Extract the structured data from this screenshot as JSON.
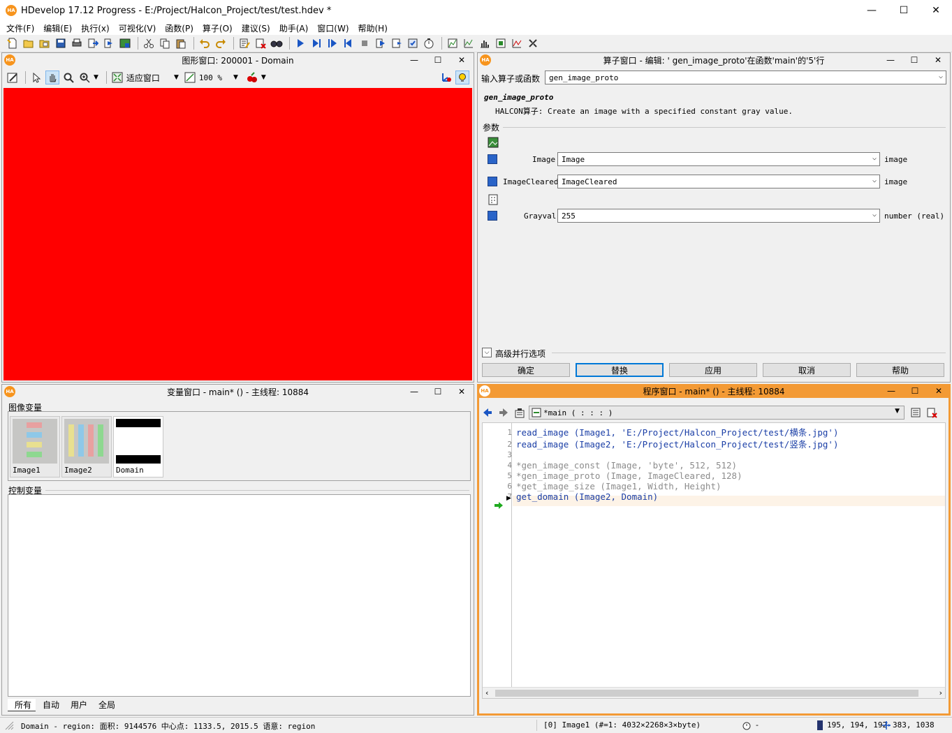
{
  "window": {
    "title": "HDevelop 17.12 Progress - E:/Project/Halcon_Project/test/test.hdev *",
    "logo": "HA",
    "minimize": "—",
    "maximize": "☐",
    "close": "✕"
  },
  "menu": [
    "文件(F)",
    "编辑(E)",
    "执行(x)",
    "可视化(V)",
    "函数(P)",
    "算子(O)",
    "建议(S)",
    "助手(A)",
    "窗口(W)",
    "帮助(H)"
  ],
  "graphics_window": {
    "title": "图形窗口: 200001 - Domain",
    "fit_label": "适应窗口",
    "zoom_label": "100 %",
    "canvas_color": "#ff0000"
  },
  "operator_window": {
    "title": "算子窗口 - 编辑: ' gen_image_proto'在函数'main'的'5'行",
    "input_label": "输入算子或函数",
    "input_value": "gen_image_proto",
    "op_name": "gen_image_proto",
    "op_desc": "HALCON算子: Create an image with a specified constant gray value.",
    "params_label": "参数",
    "params": [
      {
        "name": "Image",
        "value": "Image",
        "type": "image"
      },
      {
        "name": "ImageCleared",
        "value": "ImageCleared",
        "type": "image"
      },
      {
        "name": "Grayval",
        "value": "255",
        "type": "number (real)"
      }
    ],
    "advanced_label": "高级并行选项",
    "buttons": {
      "ok": "确定",
      "replace": "替换",
      "apply": "应用",
      "cancel": "取消",
      "help": "帮助"
    }
  },
  "variable_window": {
    "title": "变量窗口 - main* () - 主线程: 10884",
    "image_vars_label": "图像变量",
    "image_vars": [
      "Image1",
      "Image2",
      "Domain"
    ],
    "control_vars_label": "控制变量",
    "tabs": [
      "所有",
      "自动",
      "用户",
      "全局"
    ]
  },
  "program_window": {
    "title": "程序窗口 - main* () - 主线程: 10884",
    "proc_select": "main ( : : : )",
    "proc_marker": "*",
    "lines": [
      {
        "n": "1",
        "text": "read_image (Image1, 'E:/Project/Halcon_Project/test/横条.jpg')",
        "style": "blue"
      },
      {
        "n": "2",
        "text": "read_image (Image2, 'E:/Project/Halcon_Project/test/竖条.jpg')",
        "style": "blue"
      },
      {
        "n": "3",
        "text": "",
        "style": "blue"
      },
      {
        "n": "4",
        "text": "*gen_image_const (Image, 'byte', 512, 512)",
        "style": "gray"
      },
      {
        "n": "5",
        "text": "*gen_image_proto (Image, ImageCleared, 128)",
        "style": "gray"
      },
      {
        "n": "6",
        "text": "*get_image_size (Image1, Width, Height)",
        "style": "gray"
      },
      {
        "n": "7",
        "text": "get_domain (Image2, Domain)",
        "style": "blue"
      }
    ]
  },
  "status": {
    "left": "Domain - region: 面积: 9144576 中心点: 1133.5, 2015.5 语意: region",
    "image_info": "[0] Image1 (#=1: 4032×2268×3×byte)",
    "dash": "-",
    "rgb": "195, 194, 192",
    "coords": "383, 1038"
  },
  "colors": {
    "accent": "#f39a35",
    "canvas": "#ff0000",
    "code_blue": "#1a3ea6",
    "code_gray": "#8c8c8c"
  }
}
